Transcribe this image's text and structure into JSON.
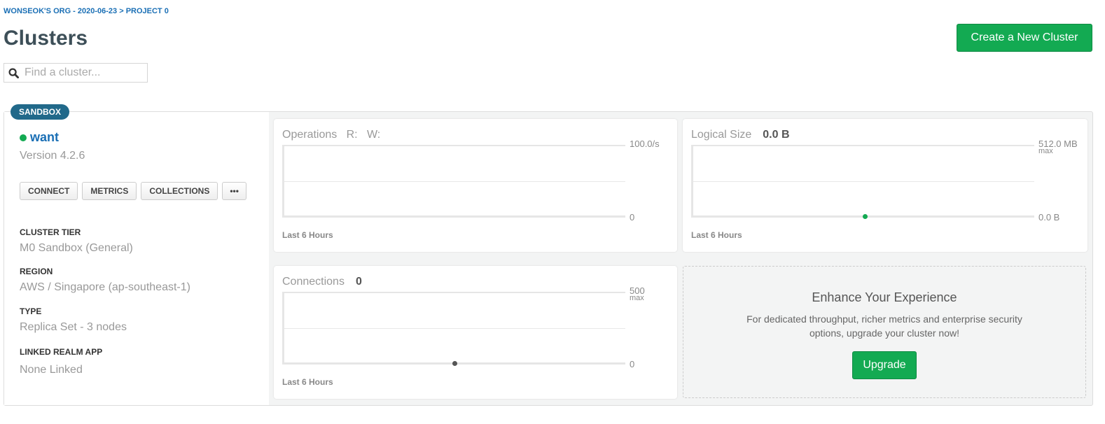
{
  "breadcrumb": "WONSEOK'S ORG - 2020-06-23 > PROJECT 0",
  "page_title": "Clusters",
  "search": {
    "placeholder": "Find a cluster...",
    "value": ""
  },
  "create_button": "Create a New Cluster",
  "cluster": {
    "badge": "SANDBOX",
    "name": "want",
    "status_color": "#13aa52",
    "version": "Version 4.2.6",
    "buttons": [
      "CONNECT",
      "METRICS",
      "COLLECTIONS",
      "•••"
    ],
    "details": [
      {
        "label": "CLUSTER TIER",
        "value": "M0 Sandbox (General)"
      },
      {
        "label": "REGION",
        "value": "AWS / Singapore (ap-southeast-1)"
      },
      {
        "label": "TYPE",
        "value": "Replica Set - 3 nodes"
      },
      {
        "label": "LINKED REALM APP",
        "value": "None Linked"
      }
    ]
  },
  "charts": [
    {
      "title": "Operations",
      "extra": "R:   W:",
      "value": "",
      "ymax": "100.0/s",
      "ymax_sub": "",
      "ymin": "0",
      "footer": "Last 6 Hours"
    },
    {
      "title": "Logical Size",
      "value": "0.0 B",
      "ymax": "512.0 MB",
      "ymax_sub": "max",
      "ymin": "0.0 B",
      "footer": "Last 6 Hours",
      "point_color": "#13aa52"
    },
    {
      "title": "Connections",
      "value": "0",
      "ymax": "500",
      "ymax_sub": "max",
      "ymin": "0",
      "footer": "Last 6 Hours",
      "point_color": "#555555"
    }
  ],
  "upsell": {
    "title": "Enhance Your Experience",
    "text": "For dedicated throughput, richer metrics and enterprise security options, upgrade your cluster now!",
    "button": "Upgrade"
  }
}
